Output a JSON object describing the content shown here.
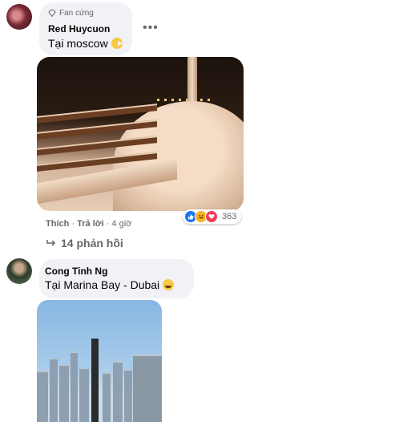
{
  "comment1": {
    "badge": "Fan cứng",
    "author": "Red Huycuon",
    "text": "Tại moscow",
    "more_label": "•••",
    "actions": {
      "like": "Thích",
      "separator": " · ",
      "reply": "Trả lời",
      "time": "4 giờ"
    },
    "reactions": {
      "count": "363",
      "icons": [
        "like-icon",
        "haha-icon",
        "love-icon"
      ]
    },
    "replies_label": "14 phản hồi"
  },
  "comment2": {
    "author": "Cong Tinh Ng",
    "text": "Tại Marina Bay - Dubai"
  },
  "colors": {
    "bubble": "#f0f2f5",
    "secondary_text": "#65676b",
    "like_blue": "#1877f2",
    "love_red": "#f33e58",
    "haha_yellow": "#f7b125"
  }
}
